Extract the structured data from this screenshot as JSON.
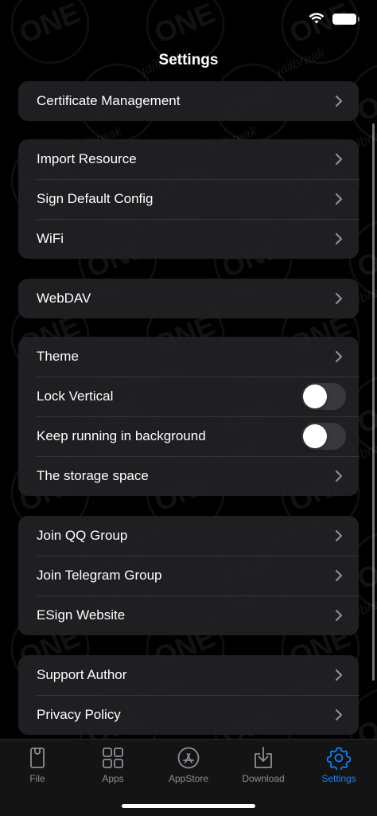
{
  "status_bar": {
    "wifi_icon": "wifi-icon",
    "battery_icon": "battery-icon"
  },
  "nav": {
    "title": "Settings"
  },
  "watermark": {
    "logo_text": "ONE",
    "sub_text": "jailbreak"
  },
  "groups": [
    {
      "items": [
        {
          "label": "Certificate Management",
          "accessory": "chevron"
        }
      ]
    },
    {
      "items": [
        {
          "label": "Import Resource",
          "accessory": "chevron"
        },
        {
          "label": "Sign Default Config",
          "accessory": "chevron"
        },
        {
          "label": "WiFi",
          "accessory": "chevron"
        }
      ]
    },
    {
      "items": [
        {
          "label": "WebDAV",
          "accessory": "chevron"
        }
      ]
    },
    {
      "items": [
        {
          "label": "Theme",
          "accessory": "chevron"
        },
        {
          "label": "Lock Vertical",
          "accessory": "toggle",
          "on": false
        },
        {
          "label": "Keep running in background",
          "accessory": "toggle",
          "on": false
        },
        {
          "label": "The storage space",
          "accessory": "chevron"
        }
      ]
    },
    {
      "items": [
        {
          "label": "Join QQ Group",
          "accessory": "chevron"
        },
        {
          "label": "Join Telegram Group",
          "accessory": "chevron"
        },
        {
          "label": "ESign Website",
          "accessory": "chevron"
        }
      ]
    },
    {
      "items": [
        {
          "label": "Support Author",
          "accessory": "chevron"
        },
        {
          "label": "Privacy Policy",
          "accessory": "chevron"
        }
      ]
    }
  ],
  "tabs": [
    {
      "label": "File",
      "icon": "file-icon",
      "active": false
    },
    {
      "label": "Apps",
      "icon": "apps-grid-icon",
      "active": false
    },
    {
      "label": "AppStore",
      "icon": "appstore-icon",
      "active": false
    },
    {
      "label": "Download",
      "icon": "download-icon",
      "active": false
    },
    {
      "label": "Settings",
      "icon": "gear-icon",
      "active": true
    }
  ],
  "colors": {
    "background": "#000000",
    "cell": "#222224",
    "accent": "#0a84ff",
    "inactive_tab": "#8e8e93",
    "chevron": "#8e8e93"
  }
}
